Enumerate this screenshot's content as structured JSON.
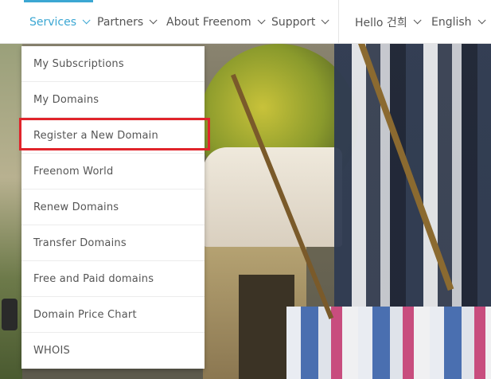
{
  "nav": {
    "items": [
      {
        "label": "Services",
        "active": true
      },
      {
        "label": "Partners",
        "active": false
      },
      {
        "label": "About Freenom",
        "active": false
      },
      {
        "label": "Support",
        "active": false
      }
    ],
    "user_greeting": "Hello 건희",
    "language": "English"
  },
  "dropdown": {
    "items": [
      "My Subscriptions",
      "My Domains",
      "Register a New Domain",
      "Freenom World",
      "Renew Domains",
      "Transfer Domains",
      "Free and Paid domains",
      "Domain Price Chart",
      "WHOIS"
    ],
    "highlighted_index": 2
  },
  "colors": {
    "accent": "#3ba7d3",
    "highlight": "#e0242b",
    "text": "#555555"
  }
}
